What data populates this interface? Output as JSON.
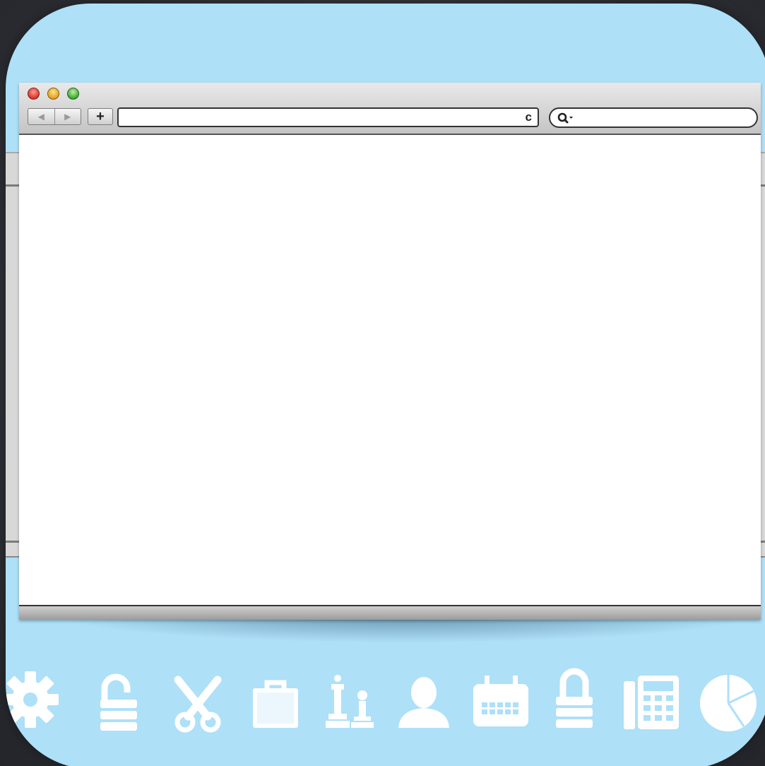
{
  "colors": {
    "tile_background": "#aee0f8",
    "page_background": "#2c2e33",
    "close_button": "#d9352a",
    "minimize_button": "#e3a020",
    "zoom_button": "#3da834",
    "icon_fill": "#ffffff"
  },
  "browser": {
    "toolbar": {
      "traffic_lights": [
        "close",
        "minimize",
        "zoom"
      ],
      "back_icon": "triangle-left-icon",
      "forward_icon": "triangle-right-icon",
      "new_tab_label": "+",
      "reload_glyph": "c",
      "url_value": "",
      "search_value": ""
    },
    "content": ""
  },
  "dock_icons": [
    "gear-icon",
    "unlocked-padlock-icon",
    "scissors-icon",
    "briefcase-icon",
    "chess-pieces-icon",
    "user-icon",
    "calendar-icon",
    "padlock-icon",
    "calculator-icon",
    "pie-chart-icon"
  ]
}
